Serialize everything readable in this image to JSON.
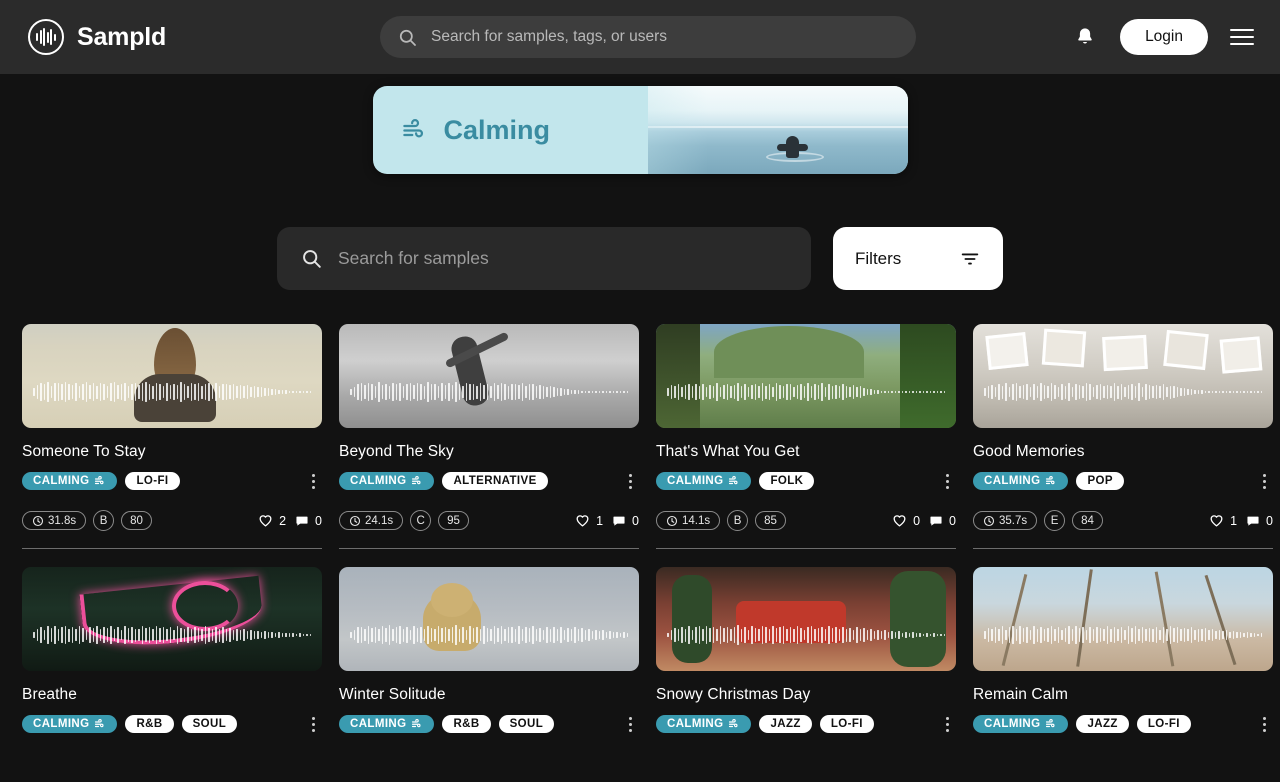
{
  "header": {
    "brand_name": "Sampld",
    "brand_logo_icon": "waveform-circle-icon",
    "search": {
      "placeholder": "Search for samples, tags, or users",
      "value": "",
      "icon": "search-icon"
    },
    "notifications_icon": "bell-icon",
    "login_label": "Login",
    "menu_icon": "hamburger-menu-icon"
  },
  "hero": {
    "title": "Calming",
    "icon": "wind-icon",
    "background_color": "#c2e6ec",
    "title_color": "#3a8ca1"
  },
  "search_row": {
    "search": {
      "placeholder": "Search for samples",
      "value": "",
      "icon": "search-icon"
    },
    "filters_label": "Filters",
    "filters_icon": "filter-icon"
  },
  "accent": {
    "mood_tag_color": "#3a9bb0",
    "genre_tag_color": "#ffffff",
    "page_bg": "#121212"
  },
  "samples": [
    {
      "title": "Someone To Stay",
      "mood_tag": "CALMING",
      "mood_icon": "wind-icon",
      "genres": [
        "LO-FI"
      ],
      "duration": "31.8s",
      "key": "B",
      "bpm": "80",
      "likes": "2",
      "comments": "0",
      "thumb_style": "field-woman",
      "waveform": [
        30,
        55,
        70,
        62,
        75,
        48,
        66,
        72,
        58,
        80,
        64,
        52,
        70,
        45,
        62,
        76,
        54,
        68,
        50,
        73,
        60,
        46,
        66,
        78,
        55,
        64,
        70,
        48,
        60,
        72,
        52,
        68,
        74,
        58,
        50,
        66,
        62,
        45,
        70,
        56,
        64,
        52,
        76,
        60,
        48,
        68,
        58,
        72,
        50,
        62,
        66,
        54,
        70,
        46,
        58,
        64,
        52,
        60,
        48,
        56,
        44,
        52,
        40,
        48,
        36,
        42,
        30,
        34,
        26,
        22,
        18,
        14,
        12,
        10,
        8,
        7,
        6,
        5,
        5,
        4
      ]
    },
    {
      "title": "Beyond The Sky",
      "mood_tag": "CALMING",
      "mood_icon": "wind-icon",
      "genres": [
        "ALTERNATIVE"
      ],
      "duration": "24.1s",
      "key": "C",
      "bpm": "95",
      "likes": "1",
      "comments": "0",
      "thumb_style": "bw-dancer",
      "waveform": [
        22,
        40,
        58,
        66,
        52,
        70,
        62,
        48,
        74,
        56,
        64,
        50,
        68,
        58,
        72,
        46,
        60,
        66,
        54,
        70,
        62,
        50,
        76,
        58,
        64,
        48,
        70,
        56,
        66,
        52,
        74,
        60,
        48,
        68,
        58,
        64,
        50,
        72,
        56,
        62,
        46,
        68,
        54,
        70,
        58,
        50,
        64,
        60,
        52,
        66,
        48,
        58,
        62,
        44,
        54,
        50,
        42,
        46,
        38,
        34,
        30,
        26,
        22,
        18,
        15,
        12,
        10,
        9,
        8,
        7,
        6,
        6,
        5,
        5,
        4,
        4,
        4,
        3,
        3,
        3
      ]
    },
    {
      "title": "That's What You Get",
      "mood_tag": "CALMING",
      "mood_icon": "wind-icon",
      "genres": [
        "FOLK"
      ],
      "duration": "14.1s",
      "key": "B",
      "bpm": "85",
      "likes": "0",
      "comments": "0",
      "thumb_style": "hills",
      "waveform": [
        34,
        52,
        46,
        60,
        40,
        56,
        64,
        44,
        58,
        50,
        62,
        42,
        54,
        48,
        66,
        38,
        52,
        60,
        44,
        56,
        70,
        48,
        62,
        40,
        54,
        58,
        46,
        66,
        50,
        60,
        42,
        68,
        52,
        46,
        58,
        64,
        40,
        54,
        62,
        48,
        70,
        44,
        58,
        52,
        66,
        38,
        60,
        50,
        56,
        44,
        62,
        48,
        40,
        54,
        36,
        44,
        30,
        26,
        20,
        16,
        13,
        11,
        9,
        8,
        7,
        6,
        6,
        5,
        5,
        5,
        4,
        4,
        4,
        4,
        3,
        3,
        3,
        3,
        3,
        3
      ]
    },
    {
      "title": "Good Memories",
      "mood_tag": "CALMING",
      "mood_icon": "wind-icon",
      "genres": [
        "POP"
      ],
      "duration": "35.7s",
      "key": "E",
      "bpm": "84",
      "likes": "1",
      "comments": "0",
      "thumb_style": "polaroids",
      "waveform": [
        28,
        44,
        56,
        38,
        62,
        50,
        66,
        42,
        58,
        70,
        46,
        54,
        64,
        40,
        60,
        48,
        72,
        52,
        44,
        66,
        56,
        38,
        62,
        50,
        68,
        42,
        58,
        54,
        46,
        70,
        60,
        40,
        52,
        64,
        48,
        56,
        44,
        66,
        50,
        62,
        38,
        54,
        58,
        46,
        68,
        42,
        60,
        52,
        44,
        56,
        48,
        62,
        40,
        50,
        44,
        38,
        32,
        28,
        24,
        20,
        16,
        14,
        12,
        10,
        9,
        8,
        7,
        6,
        6,
        5,
        5,
        4,
        4,
        4,
        3,
        3,
        3,
        3,
        3,
        3
      ]
    },
    {
      "title": "Breathe",
      "mood_tag": "CALMING",
      "mood_icon": "wind-icon",
      "genres": [
        "R&B",
        "SOUL"
      ],
      "thumb_style": "neon-breathe",
      "waveform": [
        26,
        48,
        62,
        40,
        70,
        54,
        66,
        44,
        58,
        72,
        50,
        62,
        46,
        68,
        56,
        40,
        64,
        52,
        70,
        44,
        60,
        54,
        66,
        48,
        58,
        42,
        70,
        56,
        62,
        50,
        46,
        68,
        54,
        60,
        44,
        66,
        52,
        58,
        48,
        64,
        42,
        70,
        56,
        50,
        62,
        46,
        60,
        54,
        48,
        66,
        52,
        44,
        58,
        50,
        62,
        46,
        54,
        40,
        48,
        36,
        44,
        32,
        38,
        28,
        34,
        24,
        30,
        20,
        26,
        18,
        22,
        14,
        18,
        12,
        14,
        10,
        12,
        8,
        8,
        6
      ]
    },
    {
      "title": "Winter Solitude",
      "mood_tag": "CALMING",
      "mood_icon": "wind-icon",
      "genres": [
        "R&B",
        "SOUL"
      ],
      "thumb_style": "teddy-winter",
      "waveform": [
        24,
        42,
        58,
        64,
        48,
        70,
        56,
        62,
        44,
        66,
        52,
        74,
        46,
        60,
        68,
        50,
        58,
        42,
        72,
        54,
        64,
        48,
        66,
        56,
        44,
        70,
        52,
        62,
        46,
        58,
        74,
        50,
        64,
        42,
        68,
        54,
        60,
        48,
        72,
        56,
        44,
        66,
        52,
        70,
        46,
        62,
        58,
        50,
        68,
        44,
        60,
        54,
        66,
        48,
        56,
        42,
        64,
        50,
        58,
        46,
        62,
        40,
        54,
        48,
        60,
        44,
        52,
        38,
        48,
        34,
        42,
        30,
        36,
        26,
        30,
        22,
        26,
        18,
        20,
        14
      ]
    },
    {
      "title": "Snowy Christmas Day",
      "mood_tag": "CALMING",
      "mood_icon": "wind-icon",
      "genres": [
        "JAZZ",
        "LO-FI"
      ],
      "thumb_style": "christmas",
      "waveform": [
        18,
        36,
        54,
        44,
        62,
        50,
        68,
        42,
        58,
        66,
        48,
        72,
        54,
        60,
        44,
        70,
        52,
        64,
        46,
        58,
        74,
        50,
        62,
        42,
        68,
        56,
        48,
        70,
        60,
        44,
        66,
        52,
        58,
        72,
        46,
        64,
        50,
        68,
        54,
        42,
        60,
        70,
        48,
        56,
        62,
        44,
        68,
        52,
        58,
        46,
        64,
        50,
        56,
        42,
        60,
        48,
        52,
        38,
        46,
        34,
        42,
        30,
        38,
        26,
        34,
        22,
        30,
        18,
        26,
        16,
        22,
        12,
        18,
        10,
        14,
        8,
        12,
        7,
        8,
        6
      ]
    },
    {
      "title": "Remain Calm",
      "mood_tag": "CALMING",
      "mood_icon": "wind-icon",
      "genres": [
        "JAZZ",
        "LO-FI"
      ],
      "thumb_style": "grass-sky",
      "waveform": [
        30,
        52,
        44,
        62,
        48,
        70,
        40,
        58,
        66,
        46,
        72,
        54,
        60,
        42,
        68,
        50,
        64,
        44,
        56,
        70,
        48,
        62,
        38,
        54,
        66,
        46,
        70,
        52,
        58,
        42,
        64,
        48,
        60,
        54,
        44,
        68,
        50,
        62,
        46,
        58,
        40,
        66,
        52,
        70,
        44,
        60,
        48,
        56,
        50,
        64,
        42,
        58,
        46,
        68,
        52,
        60,
        44,
        54,
        48,
        62,
        40,
        50,
        44,
        56,
        38,
        46,
        34,
        42,
        30,
        36,
        26,
        30,
        22,
        24,
        18,
        20,
        14,
        16,
        10,
        12
      ]
    }
  ]
}
